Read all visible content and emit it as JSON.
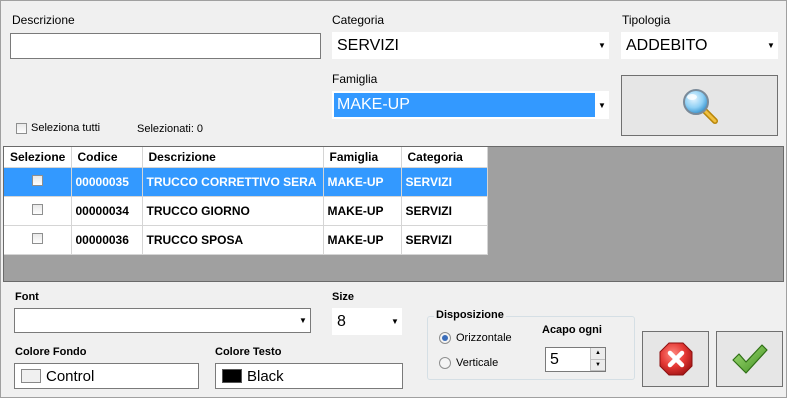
{
  "filters": {
    "descrizione_label": "Descrizione",
    "descrizione_value": "",
    "categoria_label": "Categoria",
    "categoria_value": "SERVIZI",
    "tipologia_label": "Tipologia",
    "tipologia_value": "ADDEBITO",
    "famiglia_label": "Famiglia",
    "famiglia_value": "MAKE-UP",
    "seleziona_tutti": "Seleziona tutti",
    "selezionati": "Selezionati: 0"
  },
  "grid": {
    "columns": [
      "Selezione",
      "Codice",
      "Descrizione",
      "Famiglia",
      "Categoria"
    ],
    "rows": [
      {
        "codice": "00000035",
        "descrizione": "TRUCCO CORRETTIVO SERA",
        "famiglia": "MAKE-UP",
        "categoria": "SERVIZI",
        "selected": true
      },
      {
        "codice": "00000034",
        "descrizione": "TRUCCO GIORNO",
        "famiglia": "MAKE-UP",
        "categoria": "SERVIZI",
        "selected": false
      },
      {
        "codice": "00000036",
        "descrizione": "TRUCCO SPOSA",
        "famiglia": "MAKE-UP",
        "categoria": "SERVIZI",
        "selected": false
      }
    ]
  },
  "format": {
    "font_label": "Font",
    "font_value": "",
    "size_label": "Size",
    "size_value": "8",
    "colore_fondo_label": "Colore Fondo",
    "colore_fondo_value": "Control",
    "colore_fondo_color": "#f0f0f0",
    "colore_testo_label": "Colore Testo",
    "colore_testo_value": "Black",
    "colore_testo_color": "#000000",
    "disposizione_label": "Disposizione",
    "orizzontale_label": "Orizzontale",
    "verticale_label": "Verticale",
    "acapo_label": "Acapo ogni",
    "acapo_value": "5"
  },
  "icons": {
    "search": "magnifier-icon",
    "cancel": "cancel-x-icon",
    "confirm": "checkmark-icon"
  },
  "colors": {
    "selection": "#3399ff",
    "grid_background": "#a0a0a0",
    "cancel_red": "#d9262b",
    "confirm_green": "#5aa832"
  }
}
